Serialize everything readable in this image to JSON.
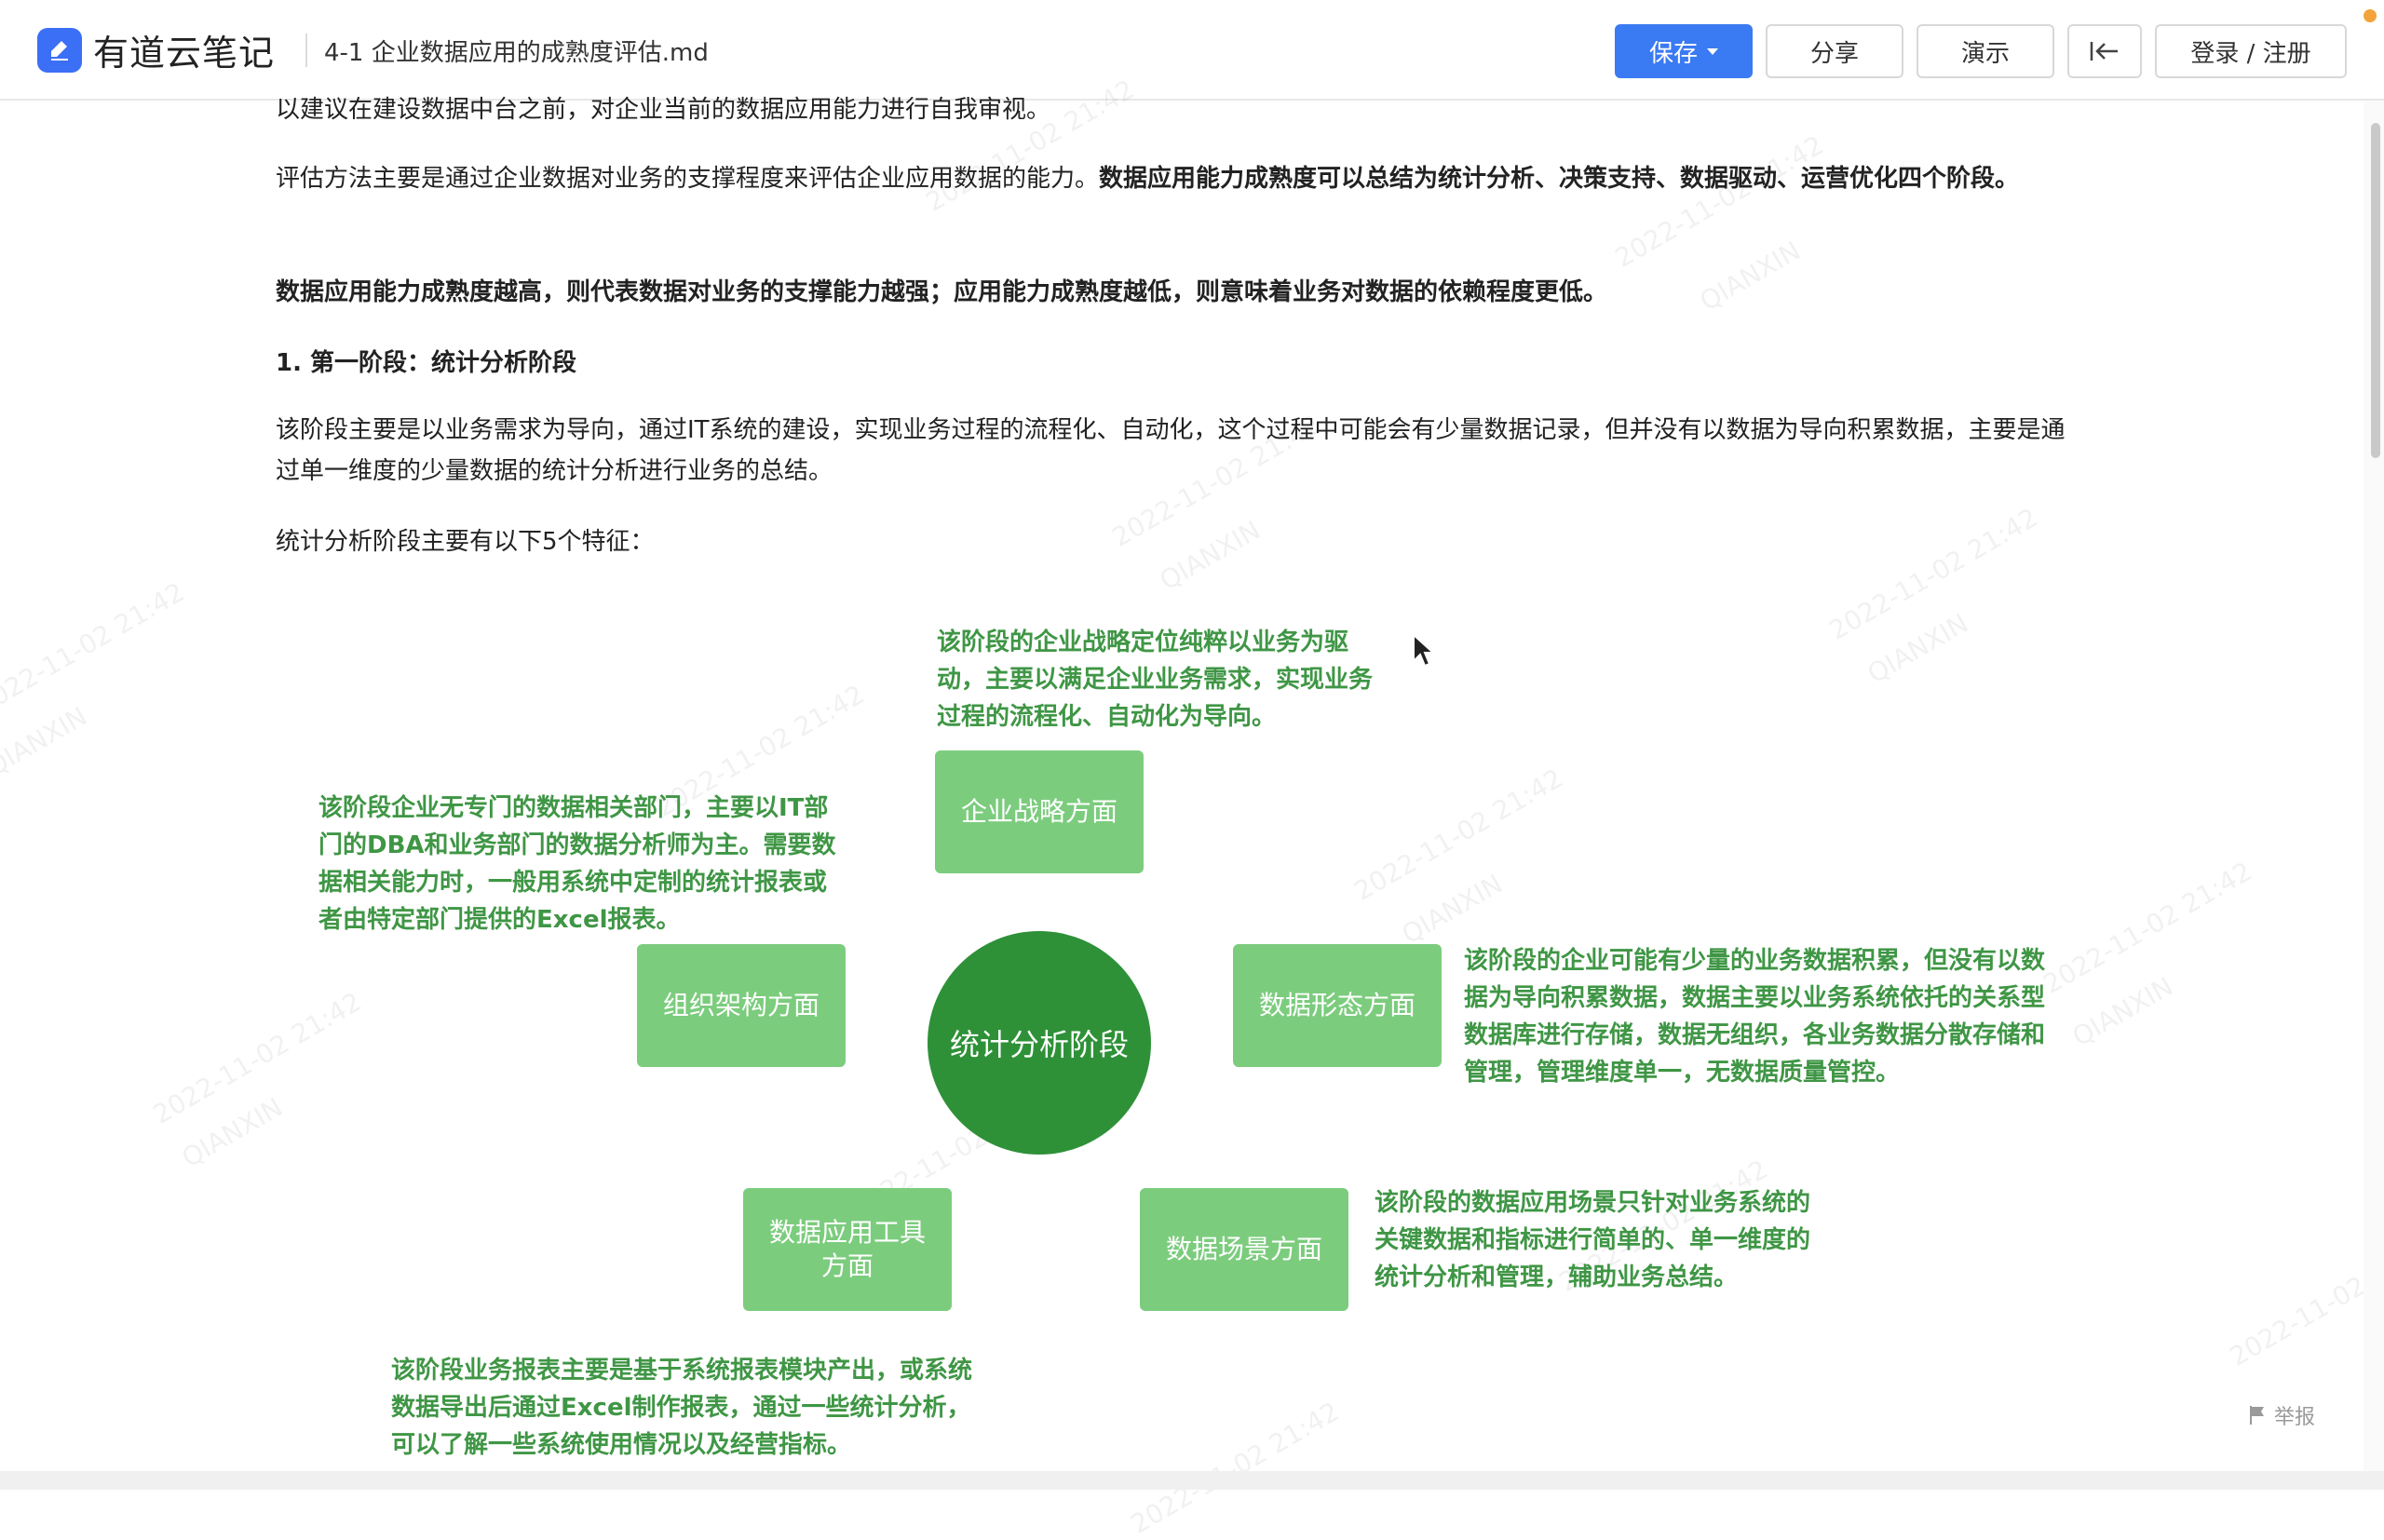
{
  "header": {
    "app_name": "有道云笔记",
    "doc_title": "4-1 企业数据应用的成熟度评估.md",
    "save_label": "保存",
    "share_label": "分享",
    "present_label": "演示",
    "login_label": "登录 / 注册"
  },
  "content": {
    "cut_line": "以建议在建设数据中台之前，对企业当前的数据应用能力进行自我审视。",
    "p1_normal": "评估方法主要是通过企业数据对业务的支撑程度来评估企业应用数据的能力。",
    "p1_bold": "数据应用能力成熟度可以总结为统计分析、决策支持、数据驱动、运营优化四个阶段。",
    "p2_bold": "数据应用能力成熟度越高，则代表数据对业务的支撑能力越强；应用能力成熟度越低，则意味着业务对数据的依赖程度更低。",
    "heading1": "1. 第一阶段：统计分析阶段",
    "p3": "该阶段主要是以业务需求为导向，通过IT系统的建设，实现业务过程的流程化、自动化，这个过程中可能会有少量数据记录，但并没有以数据为导向积累数据，主要是通过单一维度的少量数据的统计分析进行业务的总结。",
    "p4": "统计分析阶段主要有以下5个特征："
  },
  "diagram": {
    "center": "统计分析阶段",
    "boxes": {
      "strategy": "企业战略方面",
      "org": "组织架构方面",
      "data_form": "数据形态方面",
      "tools": "数据应用工具方面",
      "scenario": "数据场景方面"
    },
    "notes": {
      "strategy": "该阶段的企业战略定位纯粹以业务为驱动，主要以满足企业业务需求，实现业务过程的流程化、自动化为导向。",
      "org": "该阶段企业无专门的数据相关部门，主要以IT部门的DBA和业务部门的数据分析师为主。需要数据相关能力时，一般用系统中定制的统计报表或者由特定部门提供的Excel报表。",
      "data_form": "该阶段的企业可能有少量的业务数据积累，但没有以数据为导向积累数据，数据主要以业务系统依托的关系型数据库进行存储，数据无组织，各业务数据分散存储和管理，管理维度单一，无数据质量管控。",
      "scenario": "该阶段的数据应用场景只针对业务系统的关键数据和指标进行简单的、单一维度的统计分析和管理，辅助业务总结。",
      "tools": "该阶段业务报表主要是基于系统报表模块产出，或系统数据导出后通过Excel制作报表，通过一些统计分析，可以了解一些系统使用情况以及经营指标。"
    }
  },
  "watermark": {
    "date": "2022-11-02 21:42",
    "name": "QIANXIN"
  },
  "footer": {
    "report_label": "举报"
  },
  "colors": {
    "accent": "#3a7af2",
    "box_green": "#7ccc7e",
    "center_green": "#2e9138",
    "note_green": "#3f9645"
  }
}
